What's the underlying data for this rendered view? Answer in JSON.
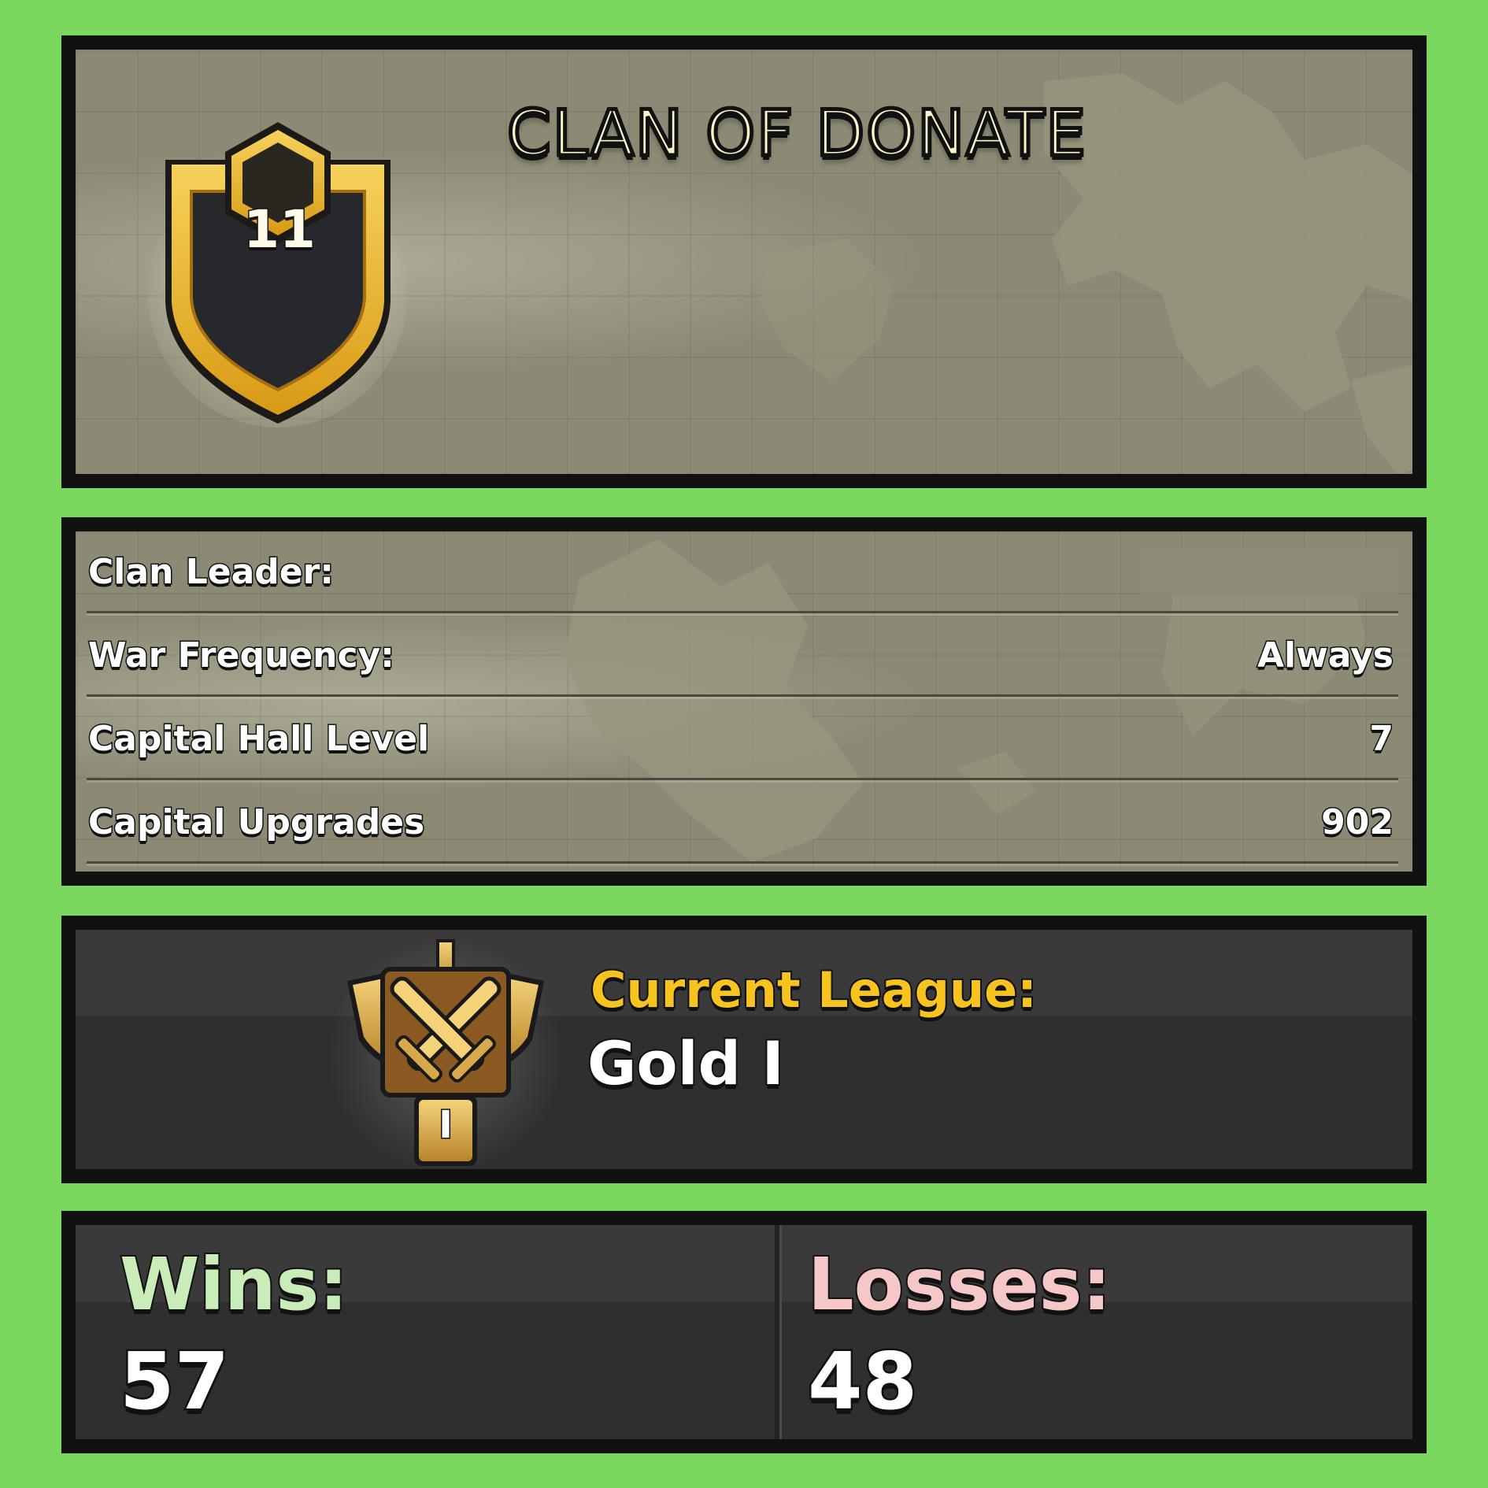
{
  "header": {
    "clan_name": "CLAN OF DONATE",
    "clan_level": "11"
  },
  "details": {
    "rows": [
      {
        "label": "Clan Leader:",
        "value": ""
      },
      {
        "label": "War Frequency:",
        "value": "Always"
      },
      {
        "label": "Capital Hall Level",
        "value": "7"
      },
      {
        "label": "Capital Upgrades",
        "value": "902"
      }
    ]
  },
  "league": {
    "heading": "Current League:",
    "name": "Gold I",
    "icon": "gold-crossed-swords-trophy-icon",
    "tier_badge": "I"
  },
  "stats": {
    "wins_label": "Wins:",
    "wins_value": "57",
    "losses_label": "Losses:",
    "losses_value": "48"
  },
  "colors": {
    "page_background": "#7bd85e",
    "panel_border": "#111111",
    "map_background": "#8c8a74",
    "dark_background": "#333333",
    "league_heading": "#f7c31e",
    "wins_text": "#c9ecb9",
    "losses_text": "#f5c7c7",
    "title_text": "#fbf6cc",
    "badge_gold": "#e8b520"
  }
}
